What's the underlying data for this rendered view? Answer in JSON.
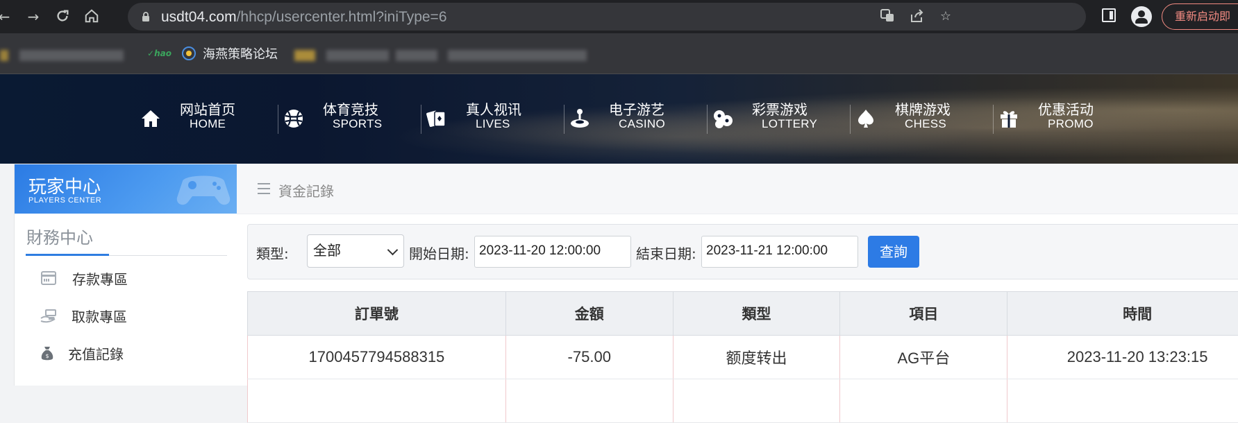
{
  "browser": {
    "url_host": "usdt04.com",
    "url_path": "/hhcp/usercenter.html?iniType=6",
    "restart_label": "重新启动即",
    "bookmarks": [
      {
        "label": "海燕策略论坛",
        "icon": "swirl-icon"
      }
    ],
    "hao_icon_text": "hao"
  },
  "site_nav": [
    {
      "cn": "网站首页",
      "en": "HOME",
      "icon": "home-icon"
    },
    {
      "cn": "体育竞技",
      "en": "SPORTS",
      "icon": "ball-icon"
    },
    {
      "cn": "真人视讯",
      "en": "LIVES",
      "icon": "cards-icon"
    },
    {
      "cn": "电子游艺",
      "en": "CASINO",
      "icon": "joystick-icon"
    },
    {
      "cn": "彩票游戏",
      "en": "LOTTERY",
      "icon": "lottery-balls-icon"
    },
    {
      "cn": "棋牌游戏",
      "en": "CHESS",
      "icon": "spade-icon"
    },
    {
      "cn": "优惠活动",
      "en": "PROMO",
      "icon": "gift-icon"
    }
  ],
  "sidebar": {
    "title": "玩家中心",
    "subtitle": "PLAYERS CENTER",
    "section_title": "財務中心",
    "items": [
      {
        "label": "存款專區",
        "icon": "deposit-card-icon"
      },
      {
        "label": "取款專區",
        "icon": "withdraw-hand-icon"
      },
      {
        "label": "充值記錄",
        "icon": "money-bag-icon"
      }
    ]
  },
  "main": {
    "page_title": "資金記錄",
    "filter": {
      "type_label": "類型:",
      "type_value": "全部",
      "start_label": "開始日期:",
      "start_value": "2023-11-20 12:00:00",
      "end_label": "結束日期:",
      "end_value": "2023-11-21 12:00:00",
      "query_label": "查詢"
    },
    "table": {
      "headers": [
        "訂單號",
        "金額",
        "類型",
        "項目",
        "時間"
      ],
      "rows": [
        [
          "1700457794588315",
          "-75.00",
          "额度转出",
          "AG平台",
          "2023-11-20 13:23:15"
        ]
      ]
    }
  }
}
